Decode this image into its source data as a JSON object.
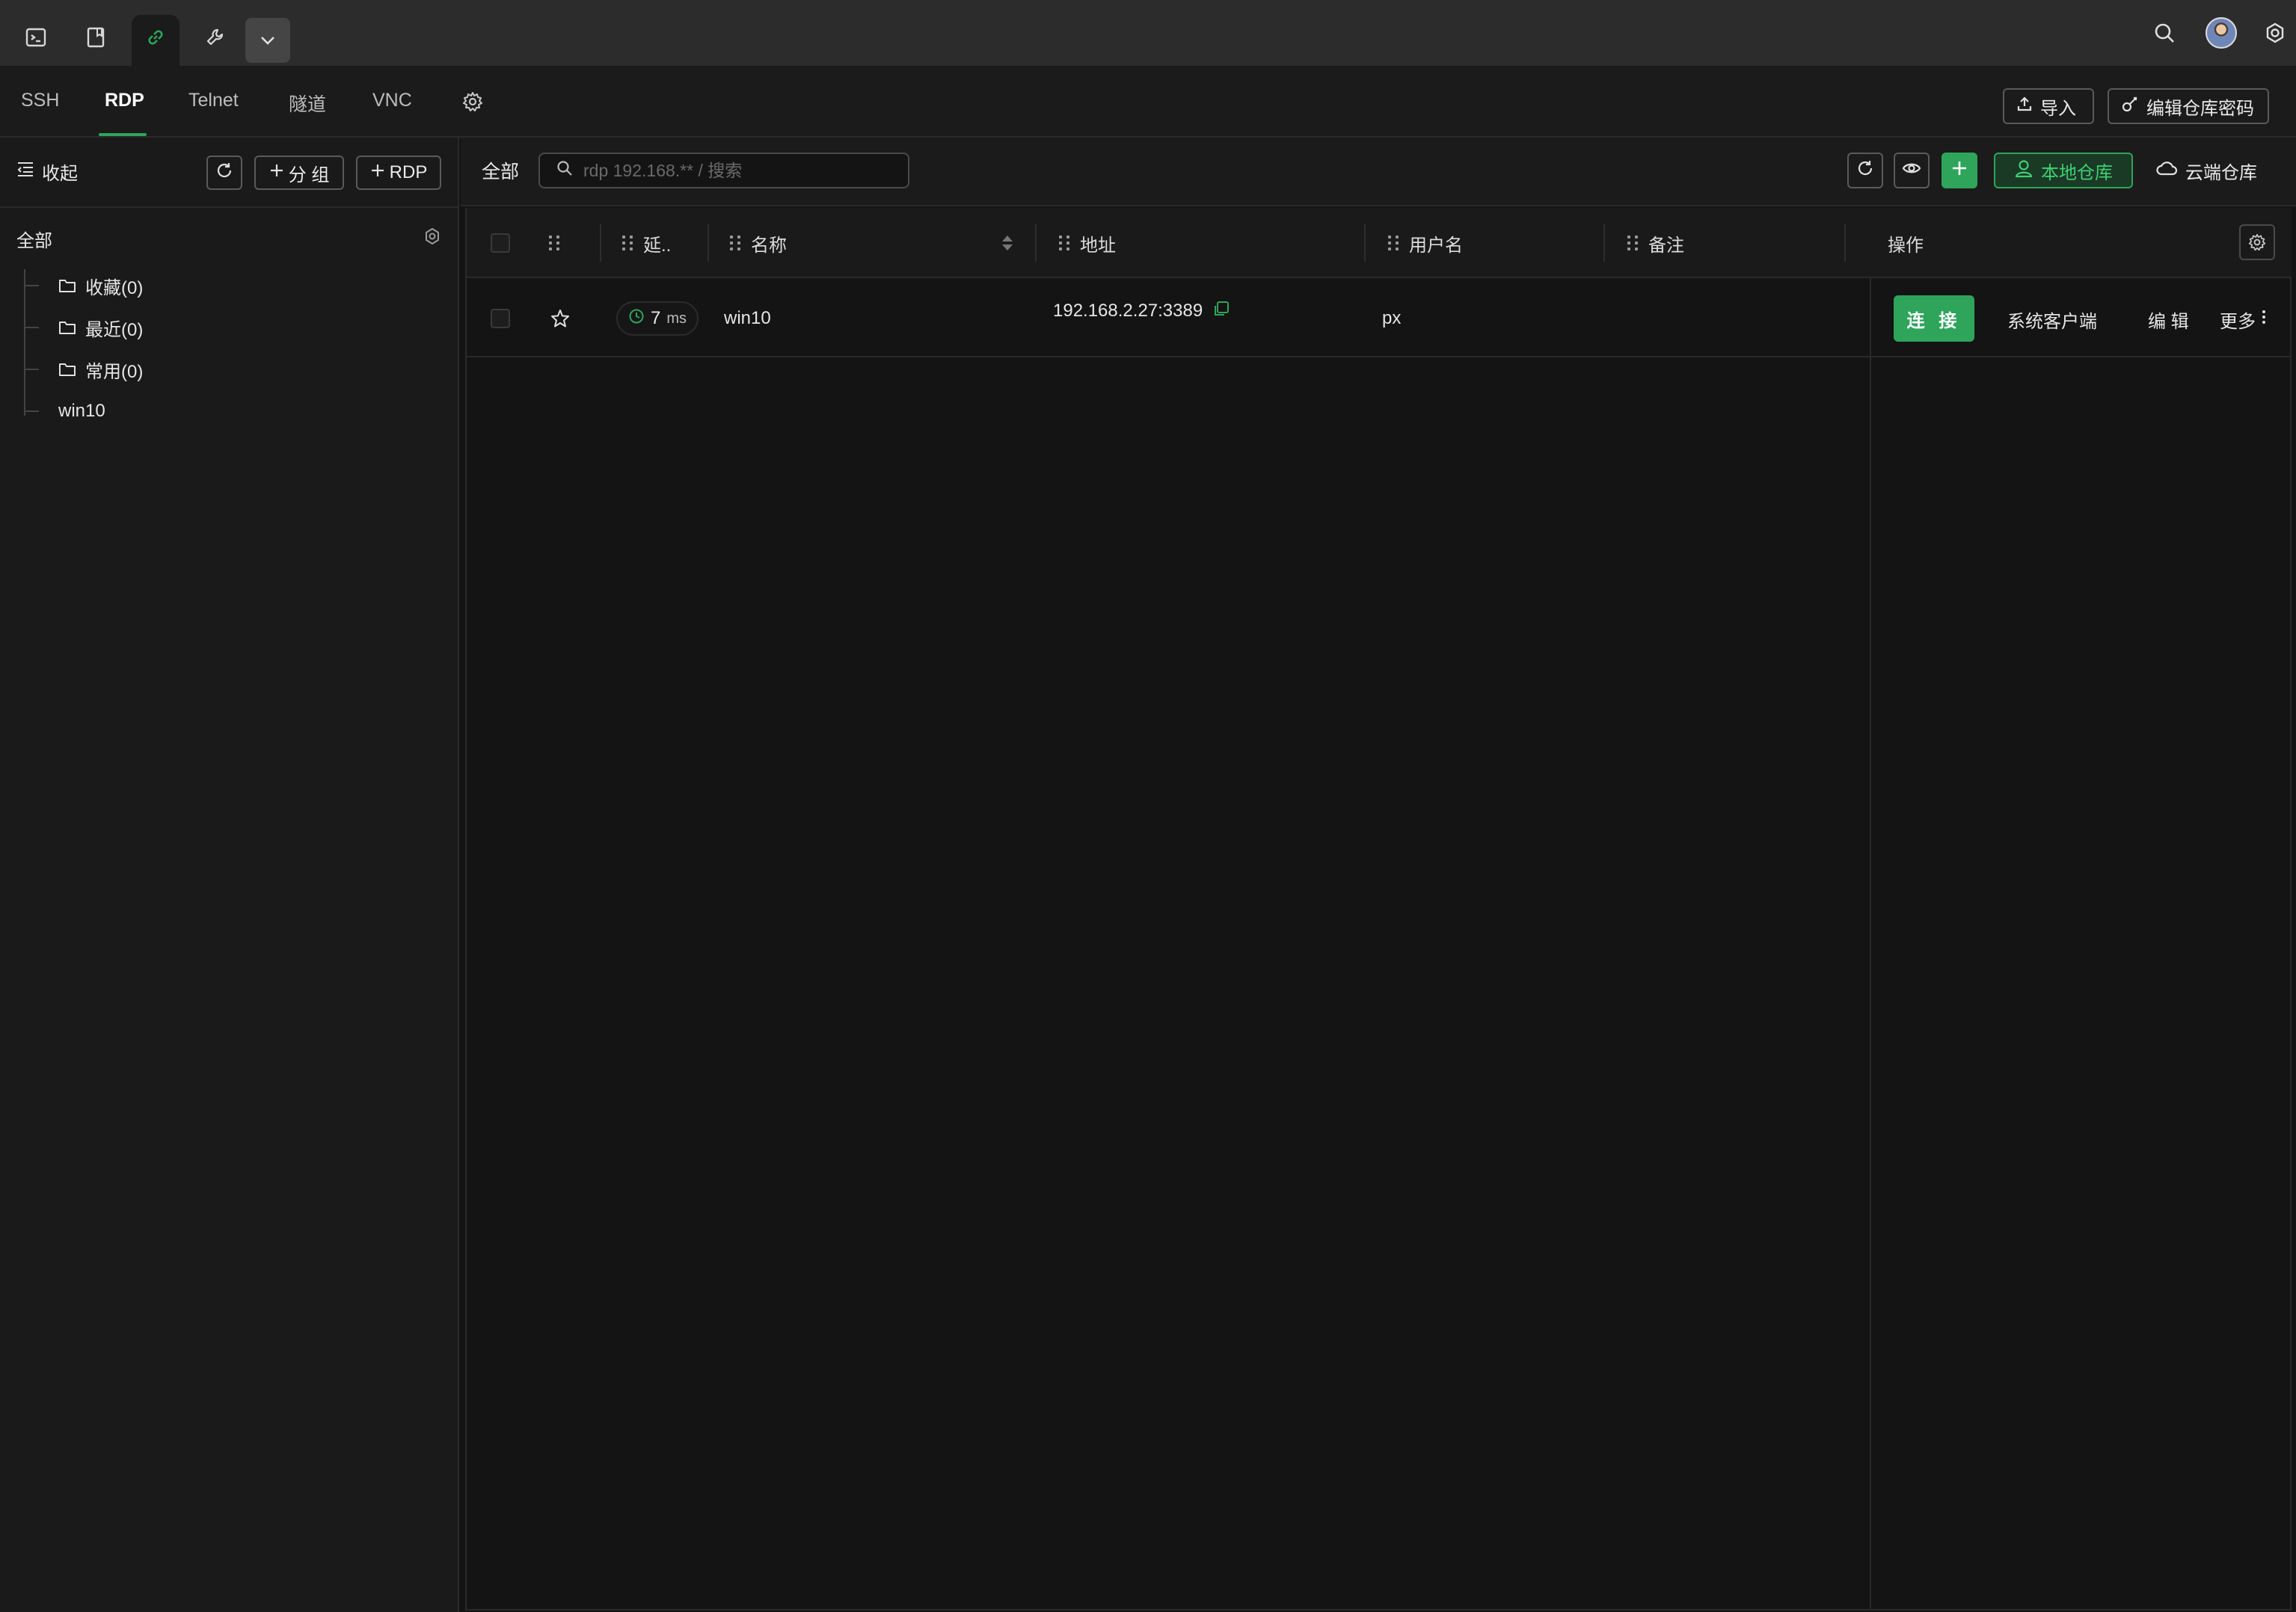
{
  "protocol_tabs": [
    "SSH",
    "RDP",
    "Telnet",
    "隧道",
    "VNC"
  ],
  "top_actions": {
    "import_label": "导入",
    "edit_vault_password_label": "编辑仓库密码"
  },
  "sidebar": {
    "collapse_label": "收起",
    "add_group_label": "分 组",
    "add_rdp_label": "RDP",
    "tree_root": "全部",
    "groups": [
      "收藏(0)",
      "最近(0)",
      "常用(0)"
    ],
    "hosts": [
      "win10"
    ]
  },
  "toolbar": {
    "scope_label": "全部",
    "search_placeholder": "rdp 192.168.** / 搜索",
    "local_vault_label": "本地仓库",
    "cloud_vault_label": "云端仓库"
  },
  "table": {
    "columns": {
      "latency": "延..",
      "name": "名称",
      "address": "地址",
      "username": "用户名",
      "remark": "备注",
      "actions": "操作"
    },
    "rows": [
      {
        "latency_value": "7",
        "latency_unit": "ms",
        "name": "win10",
        "address": "192.168.2.27:3389",
        "username": "px",
        "remark": ""
      }
    ],
    "row_actions": {
      "connect": "连 接",
      "system_client": "系统客户端",
      "edit": "编 辑",
      "more": "更多"
    }
  },
  "colors": {
    "accent": "#2ea55a",
    "background": "#141414",
    "titlebar": "#2c2c2c"
  }
}
